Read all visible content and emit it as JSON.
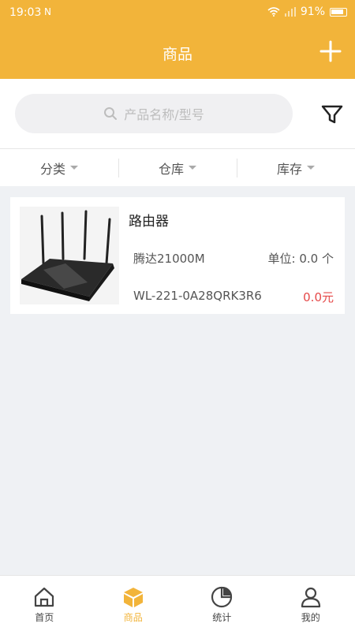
{
  "status": {
    "time": "19:03",
    "battery": "91%",
    "nfc": "N"
  },
  "header": {
    "title": "商品"
  },
  "search": {
    "placeholder": "产品名称/型号"
  },
  "tabs": [
    {
      "label": "分类"
    },
    {
      "label": "仓库"
    },
    {
      "label": "库存"
    }
  ],
  "product": {
    "name": "路由器",
    "model": "腾达21000M",
    "unit": "单位: 0.0 个",
    "code": "WL-221-0A28QRK3R6",
    "price": "0.0元"
  },
  "nav": [
    {
      "label": "首页",
      "icon": "home-icon"
    },
    {
      "label": "商品",
      "icon": "box-icon",
      "active": true
    },
    {
      "label": "统计",
      "icon": "pie-chart-icon"
    },
    {
      "label": "我的",
      "icon": "user-icon"
    }
  ],
  "colors": {
    "accent": "#f2b43a",
    "price": "#e54848"
  }
}
